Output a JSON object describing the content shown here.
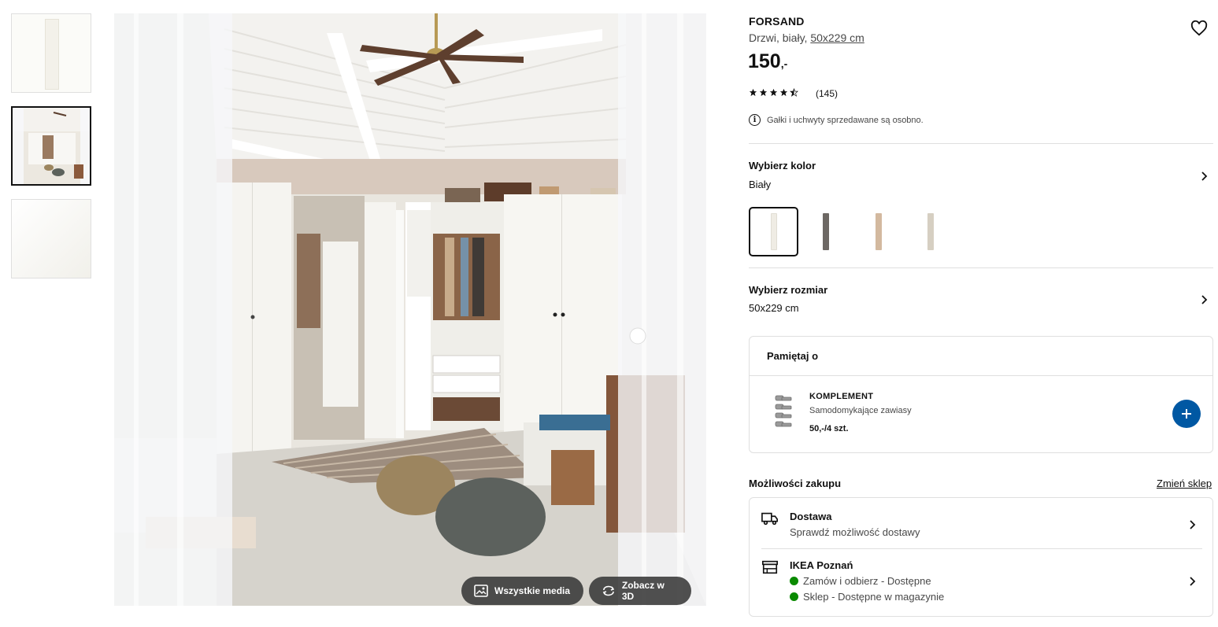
{
  "thumbnails": [
    {
      "label": "door-white"
    },
    {
      "label": "room-interior"
    },
    {
      "label": "door-detail"
    }
  ],
  "media": {
    "all_media_label": "Wszystkie media",
    "view_3d_label": "Zobacz w 3D"
  },
  "product": {
    "name": "FORSAND",
    "desc_prefix": "Drzwi, biały, ",
    "size_link": "50x229 cm",
    "price_main": "150",
    "price_suffix": ",-",
    "rating": 4.5,
    "rating_count": "(145)",
    "info_note": "Gałki i uchwyty sprzedawane są osobno."
  },
  "color": {
    "title": "Wybierz kolor",
    "selected": "Biały",
    "swatches": [
      "#efece4",
      "#6d6864",
      "#d3b99f",
      "#d6cfc2"
    ]
  },
  "size": {
    "title": "Wybierz rozmiar",
    "selected": "50x229 cm"
  },
  "remember": {
    "title": "Pamiętaj o",
    "item_name": "KOMPLEMENT",
    "item_desc": "Samodomykające zawiasy",
    "item_price": "50,-/4 szt."
  },
  "purchase": {
    "title": "Możliwości zakupu",
    "change_store": "Zmień sklep",
    "delivery_title": "Dostawa",
    "delivery_sub": "Sprawdź możliwość dostawy",
    "store_title": "IKEA Poznań",
    "store_status_1": "Zamów i odbierz - Dostępne",
    "store_status_2": "Sklep - Dostępne w magazynie"
  },
  "colors": {
    "accent_blue": "#0058a3",
    "available_green": "#0a8a00"
  }
}
